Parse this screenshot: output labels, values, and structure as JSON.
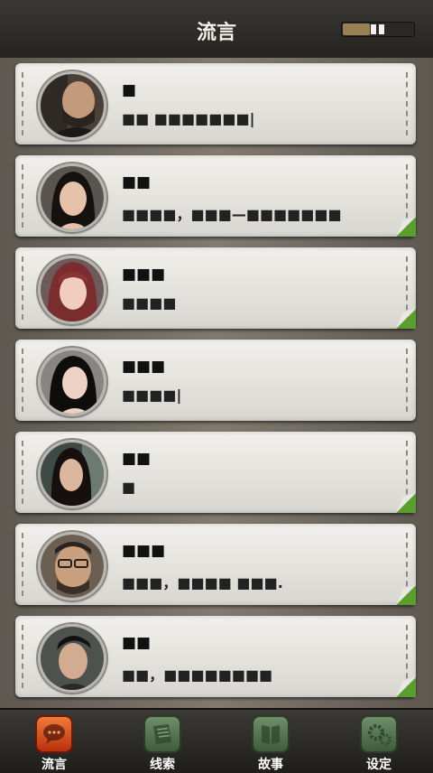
{
  "header": {
    "title": "流言"
  },
  "signal": {
    "level": 0.55
  },
  "contacts": [
    {
      "name": "■",
      "message": "■■ ■■■■■■■|"
    },
    {
      "name": "■■",
      "message": "■■■■，■■■—■■■■■■■"
    },
    {
      "name": "■■■",
      "message": "■■■■"
    },
    {
      "name": "■■■",
      "message": "■■■■|"
    },
    {
      "name": "■■",
      "message": "■"
    },
    {
      "name": "■■■",
      "message": "■■■，■■■■ ■■■."
    },
    {
      "name": "■■",
      "message": "■■，■■■■■■■■"
    }
  ],
  "tabs": [
    {
      "label": "流言"
    },
    {
      "label": "线索"
    },
    {
      "label": "故事"
    },
    {
      "label": "设定"
    }
  ]
}
